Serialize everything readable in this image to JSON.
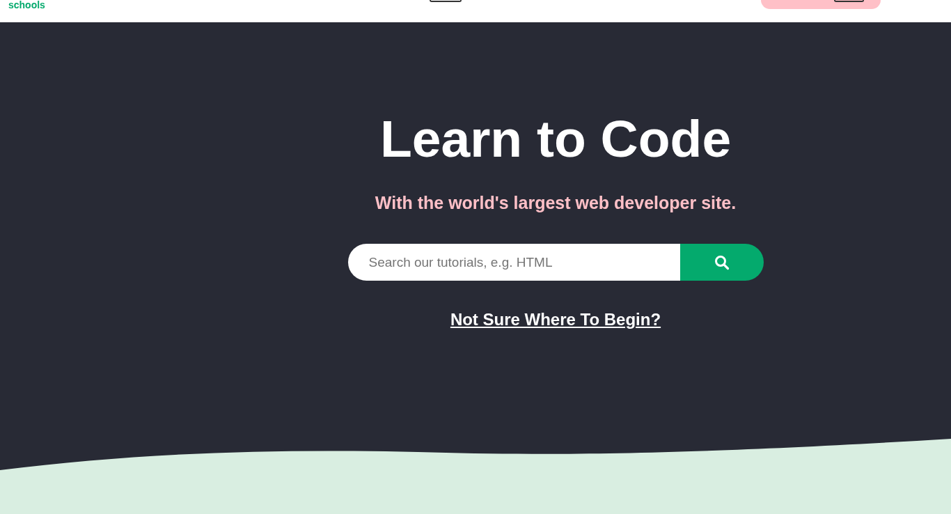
{
  "header": {
    "logo_text": "schools"
  },
  "hero": {
    "title": "Learn to Code",
    "subtitle": "With the world's largest web developer site.",
    "search": {
      "placeholder": "Search our tutorials, e.g. HTML"
    },
    "link": "Not Sure Where To Begin?"
  }
}
